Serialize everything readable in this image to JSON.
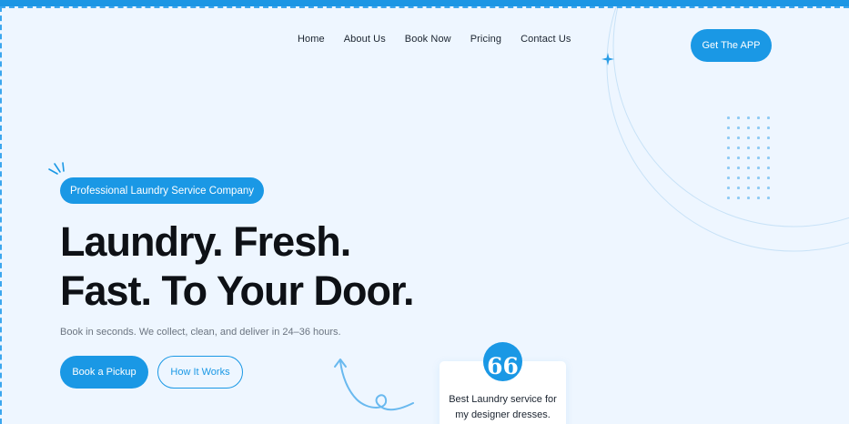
{
  "nav": {
    "items": [
      "Home",
      "About Us",
      "Book Now",
      "Pricing",
      "Contact Us"
    ],
    "cta_label": "Get The APP"
  },
  "hero": {
    "badge": "Professional Laundry Service Company",
    "headline_line1": "Laundry. Fresh.",
    "headline_line2": "Fast. To Your Door.",
    "subtext": "Book in seconds. We collect, clean, and deliver in 24–36 hours.",
    "primary_button": "Book a Pickup",
    "secondary_button": "How It Works"
  },
  "testimonial": {
    "quote_glyph": "66",
    "text_line1": "Best Laundry service for",
    "text_line2": "my designer dresses."
  },
  "colors": {
    "accent": "#1a98e5",
    "background": "#eef6ff",
    "heading": "#0e1116",
    "muted": "#6b7480"
  },
  "icons": {
    "sparkle": "sparkle-icon",
    "quote": "quote-icon",
    "squiggle_arrow": "squiggle-arrow-icon"
  }
}
